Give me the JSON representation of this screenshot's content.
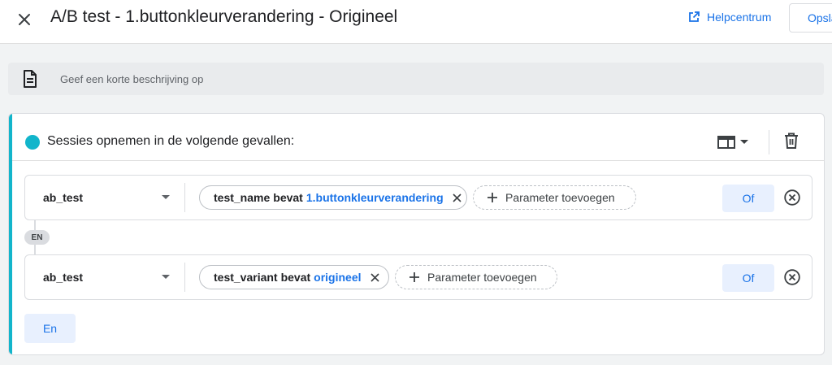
{
  "header": {
    "title": "A/B test - 1.buttonkleurverandering - Origineel",
    "help_label": "Helpcentrum",
    "save_label": "Opslaan"
  },
  "description": {
    "placeholder": "Geef een korte beschrijving op"
  },
  "condition_card": {
    "title": "Sessies opnemen in de volgende gevallen:",
    "accent_color": "#12b5cb",
    "scope_icon": "table-scope-icon",
    "delete_icon": "trash-icon",
    "rows": [
      {
        "event": "ab_test",
        "param_name": "test_name",
        "operator": "bevat",
        "param_value": "1.buttonkleurverandering",
        "add_param_label": "Parameter toevoegen",
        "or_label": "Of"
      },
      {
        "event": "ab_test",
        "param_name": "test_variant",
        "operator": "bevat",
        "param_value": "origineel",
        "add_param_label": "Parameter toevoegen",
        "or_label": "Of"
      }
    ],
    "and_badge": "EN",
    "and_button": "En"
  },
  "colors": {
    "accent_blue": "#1a73e8",
    "teal": "#12b5cb",
    "chip_blue_bg": "#e8f0fe"
  }
}
